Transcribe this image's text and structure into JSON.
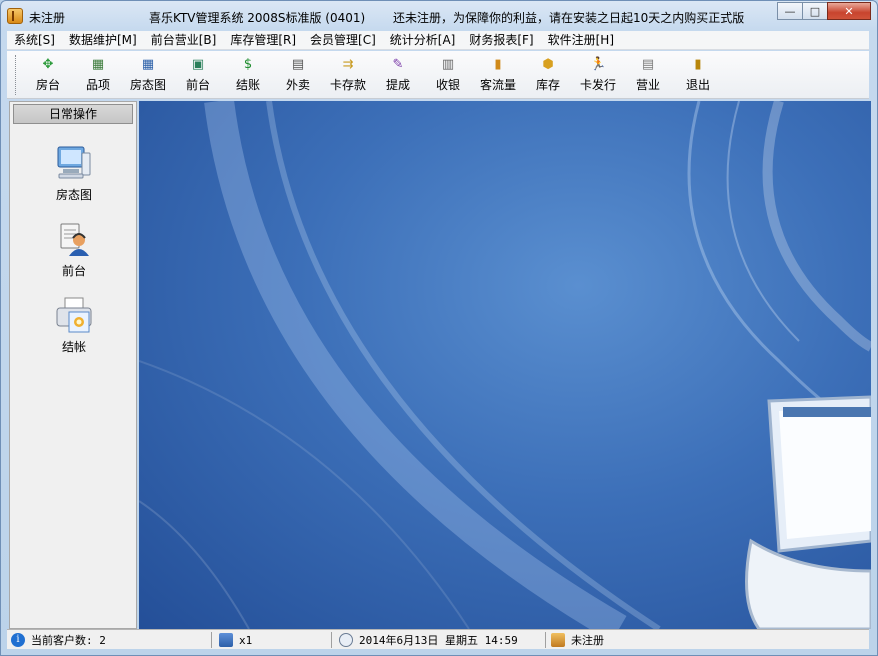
{
  "window": {
    "title_left": "未注册",
    "title_main": "喜乐KTV管理系统  2008S标准版 (0401)",
    "title_right": "还未注册，为保障你的利益，请在安装之日起10天之内购买正式版",
    "minimize": "—",
    "maximize": "□",
    "close": "✕"
  },
  "menu": {
    "items": [
      "系统[S]",
      "数据维护[M]",
      "前台营业[B]",
      "库存管理[R]",
      "会员管理[C]",
      "统计分析[A]",
      "财务报表[F]",
      "软件注册[H]"
    ]
  },
  "toolbar": {
    "buttons": [
      {
        "label": "房台",
        "icon": "compass-icon",
        "glyph": "✥",
        "color": "#2b9a3a"
      },
      {
        "label": "品项",
        "icon": "calendar-icon",
        "glyph": "▦",
        "color": "#3a7a3a"
      },
      {
        "label": "房态图",
        "icon": "grid-icon",
        "glyph": "▦",
        "color": "#2a5fa8"
      },
      {
        "label": "前台",
        "icon": "desk-icon",
        "glyph": "▣",
        "color": "#2a7f5a"
      },
      {
        "label": "结账",
        "icon": "dollar-icon",
        "glyph": "$",
        "color": "#1a8a2a"
      },
      {
        "label": "外卖",
        "icon": "box-icon",
        "glyph": "▤",
        "color": "#555555"
      },
      {
        "label": "卡存款",
        "icon": "card-icon",
        "glyph": "⇉",
        "color": "#c89a20"
      },
      {
        "label": "提成",
        "icon": "pen-icon",
        "glyph": "✎",
        "color": "#7a3aa8"
      },
      {
        "label": "收银",
        "icon": "register-icon",
        "glyph": "▥",
        "color": "#666666"
      },
      {
        "label": "客流量",
        "icon": "bar-chart-icon",
        "glyph": "▮",
        "color": "#d08a1a"
      },
      {
        "label": "库存",
        "icon": "package-icon",
        "glyph": "⬢",
        "color": "#d8a020"
      },
      {
        "label": "卡发行",
        "icon": "runner-icon",
        "glyph": "🏃",
        "color": "#222222"
      },
      {
        "label": "营业",
        "icon": "database-icon",
        "glyph": "▤",
        "color": "#7a7a7a"
      },
      {
        "label": "退出",
        "icon": "exit-door-icon",
        "glyph": "▮",
        "color": "#b8860b"
      }
    ]
  },
  "left_panel": {
    "header": "日常操作",
    "shortcuts": [
      {
        "label": "房态图",
        "icon": "computer-icon"
      },
      {
        "label": "前台",
        "icon": "receptionist-icon"
      },
      {
        "label": "结帐",
        "icon": "printer-icon"
      }
    ]
  },
  "statusbar": {
    "customers": "当前客户数: 2",
    "multiplier": "x1",
    "datetime": "2014年6月13日  星期五  14:59",
    "registration": "未注册"
  }
}
